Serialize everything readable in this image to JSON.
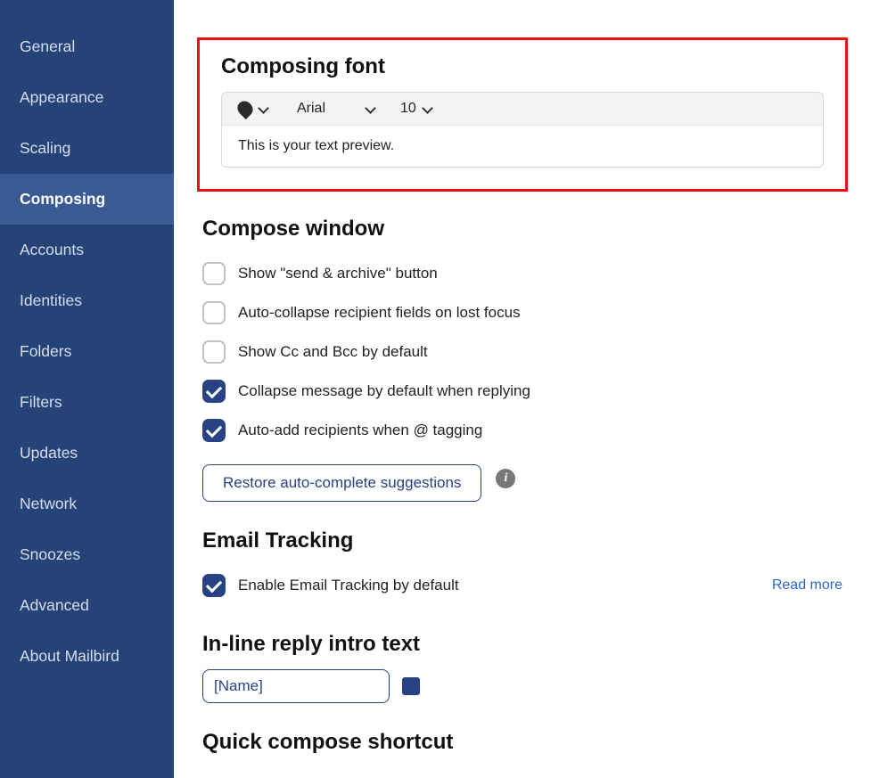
{
  "sidebar": {
    "items": [
      {
        "label": "General"
      },
      {
        "label": "Appearance"
      },
      {
        "label": "Scaling"
      },
      {
        "label": "Composing",
        "active": true
      },
      {
        "label": "Accounts"
      },
      {
        "label": "Identities"
      },
      {
        "label": "Folders"
      },
      {
        "label": "Filters"
      },
      {
        "label": "Updates"
      },
      {
        "label": "Network"
      },
      {
        "label": "Snoozes"
      },
      {
        "label": "Advanced"
      },
      {
        "label": "About Mailbird"
      }
    ]
  },
  "composingFont": {
    "title": "Composing font",
    "fontFamily": "Arial",
    "fontSize": "10",
    "previewText": "This is your text preview."
  },
  "composeWindow": {
    "title": "Compose window",
    "options": [
      {
        "label": "Show \"send & archive\" button",
        "checked": false
      },
      {
        "label": "Auto-collapse recipient fields on lost focus",
        "checked": false
      },
      {
        "label": "Show Cc and Bcc by default",
        "checked": false
      },
      {
        "label": "Collapse message by default when replying",
        "checked": true
      },
      {
        "label": "Auto-add recipients when @ tagging",
        "checked": true
      }
    ],
    "restoreBtn": "Restore auto-complete suggestions"
  },
  "emailTracking": {
    "title": "Email Tracking",
    "option": {
      "label": "Enable Email Tracking by default",
      "checked": true
    },
    "readMore": "Read more"
  },
  "inlineReply": {
    "title": "In-line reply intro text",
    "value": "[Name]",
    "color": "#274383"
  },
  "quickCompose": {
    "title": "Quick compose shortcut"
  }
}
